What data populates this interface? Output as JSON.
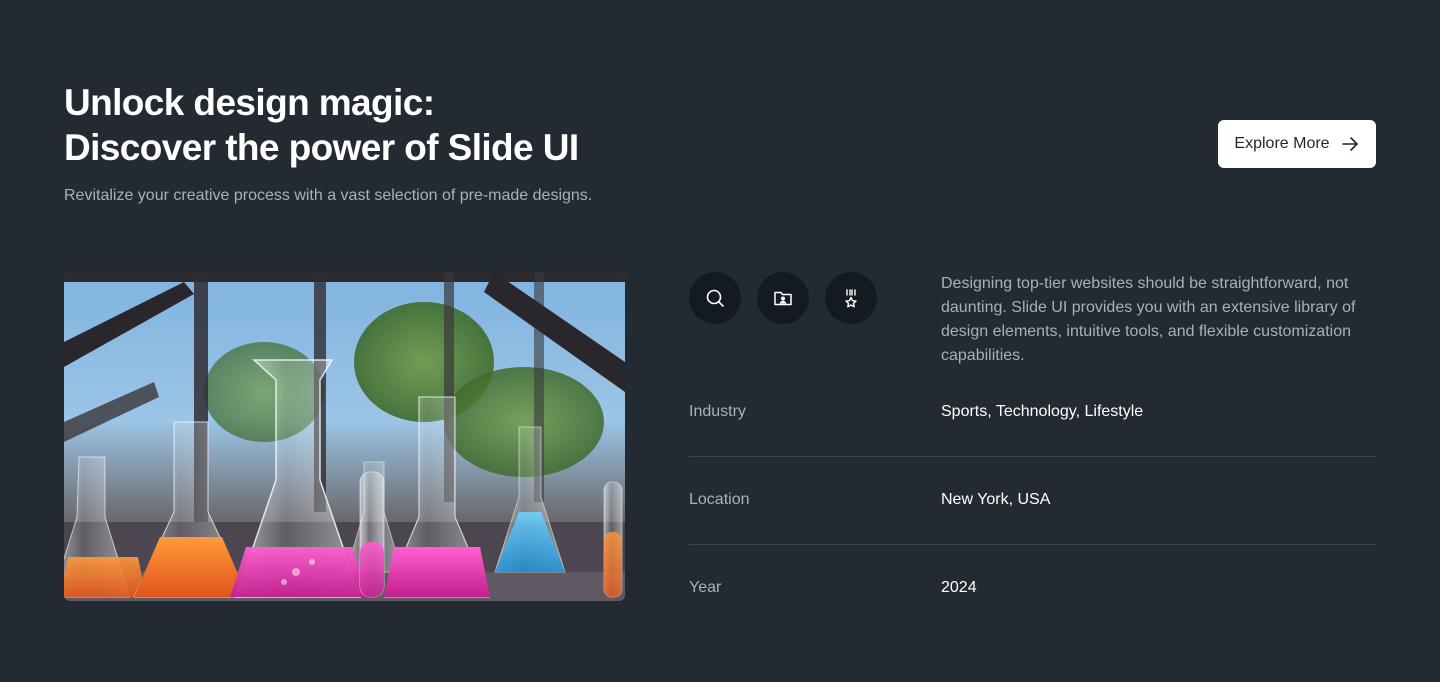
{
  "hero": {
    "title_line1": "Unlock design magic:",
    "title_line2": "Discover the power of Slide UI",
    "subtitle": "Revitalize your creative process with a vast selection of pre-made designs.",
    "cta_label": "Explore More",
    "cta_icon": "arrow-right-icon"
  },
  "icons": [
    "search-icon",
    "folder-user-icon",
    "award-icon"
  ],
  "description": "Designing top-tier websites should be straightforward, not daunting. Slide UI provides you with an extensive library of design elements, intuitive tools, and flexible customization capabilities.",
  "details": [
    {
      "label": "Industry",
      "value": "Sports, Technology, Lifestyle"
    },
    {
      "label": "Location",
      "value": "New York, USA"
    },
    {
      "label": "Year",
      "value": "2024"
    }
  ],
  "colors": {
    "background": "#242a31",
    "icon_button": "#131a21",
    "muted_text": "#a9b0b8",
    "divider": "#3c434b",
    "cta_background": "#ffffff"
  }
}
